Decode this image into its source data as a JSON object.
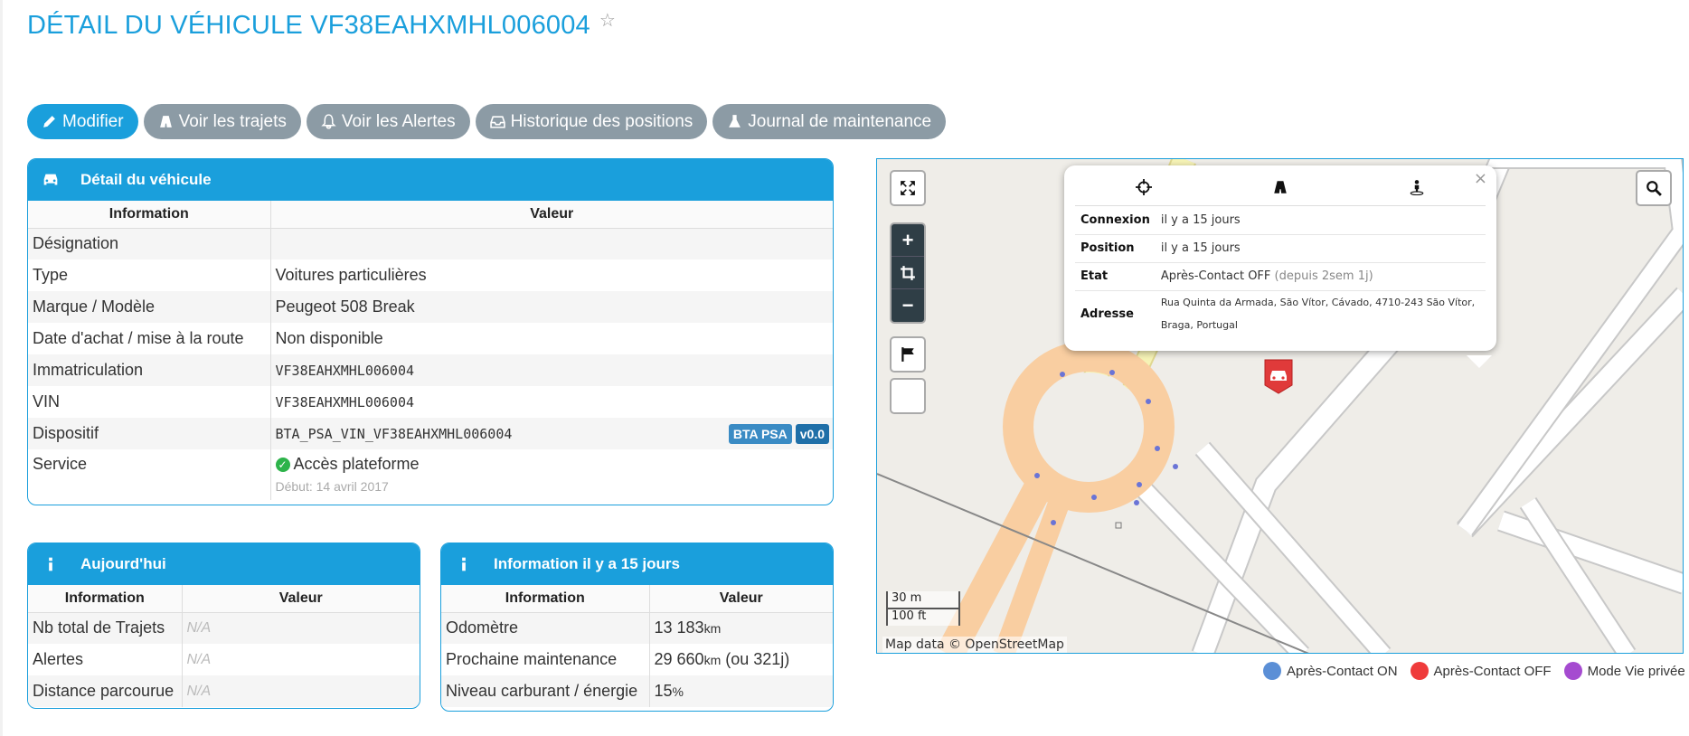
{
  "page": {
    "title": "DÉTAIL DU VÉHICULE VF38EAHXMHL006004"
  },
  "toolbar": {
    "modifier": "Modifier",
    "trajets": "Voir les trajets",
    "alertes": "Voir les Alertes",
    "historique": "Historique des positions",
    "journal": "Journal de maintenance"
  },
  "vehicle_panel": {
    "title": "Détail du véhicule",
    "col_info": "Information",
    "col_value": "Valeur",
    "rows": [
      {
        "label": "Désignation",
        "value": ""
      },
      {
        "label": "Type",
        "value": "Voitures particulières"
      },
      {
        "label": "Marque / Modèle",
        "value": "Peugeot 508 Break"
      },
      {
        "label": "Date d'achat / mise à la route",
        "value": "Non disponible"
      },
      {
        "label": "Immatriculation",
        "value": "VF38EAHXMHL006004"
      },
      {
        "label": "VIN",
        "value": "VF38EAHXMHL006004"
      },
      {
        "label": "Dispositif",
        "value": "BTA_PSA_VIN_VF38EAHXMHL006004",
        "badges": [
          "BTA PSA",
          "v0.0"
        ]
      },
      {
        "label": "Service",
        "value": "Accès plateforme",
        "sub": "Début: 14 avril 2017"
      }
    ]
  },
  "today_panel": {
    "title": "Aujourd'hui",
    "col_info": "Information",
    "col_value": "Valeur",
    "rows": [
      {
        "label": "Nb total de Trajets",
        "value": "N/A"
      },
      {
        "label": "Alertes",
        "value": "N/A"
      },
      {
        "label": "Distance parcourue",
        "value": "N/A"
      }
    ]
  },
  "info_panel": {
    "title": "Information il y a 15 jours",
    "col_info": "Information",
    "col_value": "Valeur",
    "rows": [
      {
        "label": "Odomètre",
        "value": "13 183",
        "unit": "km",
        "suffix": ""
      },
      {
        "label": "Prochaine maintenance",
        "value": "29 660",
        "unit": "km",
        "suffix": " (ou 321j)"
      },
      {
        "label": "Niveau carburant / énergie",
        "value": "15",
        "unit": "%",
        "suffix": ""
      }
    ]
  },
  "map": {
    "popup": {
      "connexion_label": "Connexion",
      "connexion_value": "il y a 15 jours",
      "position_label": "Position",
      "position_value": "il y a 15 jours",
      "etat_label": "Etat",
      "etat_value": "Après-Contact OFF",
      "etat_since": "(depuis 2sem 1j)",
      "adresse_label": "Adresse",
      "adresse_value": "Rua Quinta da Armada, São Vítor, Cávado, 4710-243 São Vítor, Braga, Portugal",
      "close": "×"
    },
    "scale_m": "30 m",
    "scale_ft": "100 ft",
    "attribution": "Map data © OpenStreetMap",
    "zoom_in": "+",
    "zoom_out": "−"
  },
  "legend": [
    {
      "label": "Après-Contact ON",
      "color": "#5b8fd6"
    },
    {
      "label": "Après-Contact OFF",
      "color": "#ef3b3b"
    },
    {
      "label": "Mode Vie privée",
      "color": "#a54bd0"
    }
  ],
  "colors": {
    "accent": "#1a9fdc",
    "button_grey": "#8c9ba5"
  }
}
